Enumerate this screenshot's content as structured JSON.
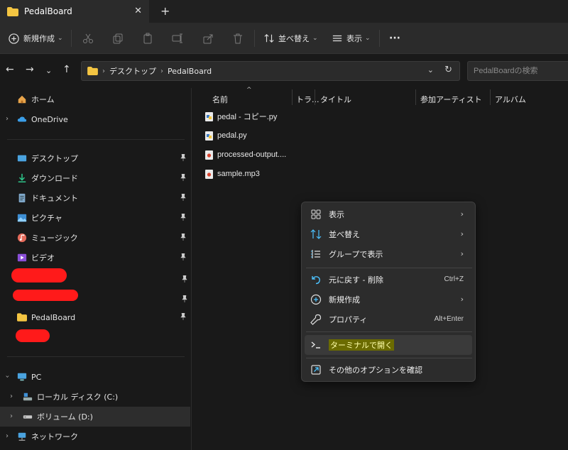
{
  "window": {
    "tab_title": "PedalBoard",
    "tab_close": "✕",
    "tab_add": "+"
  },
  "toolbar": {
    "new_label": "新規作成",
    "sort_label": "並べ替え",
    "view_label": "表示",
    "more": "···"
  },
  "address": {
    "crumbs": [
      "デスクトップ",
      "PedalBoard"
    ],
    "search_placeholder": "PedalBoardの検索"
  },
  "sidebar": {
    "items": [
      {
        "label": "ホーム"
      },
      {
        "label": "OneDrive"
      },
      {
        "label": "デスクトップ"
      },
      {
        "label": "ダウンロード"
      },
      {
        "label": "ドキュメント"
      },
      {
        "label": "ピクチャ"
      },
      {
        "label": "ミュージック"
      },
      {
        "label": "ビデオ"
      },
      {
        "label": "PedalBoard"
      },
      {
        "label": "PC"
      },
      {
        "label": "ローカル ディスク (C:)"
      },
      {
        "label": "ボリューム (D:)"
      },
      {
        "label": "ネットワーク"
      }
    ]
  },
  "columns": [
    "名前",
    "トラ...",
    "タイトル",
    "参加アーティスト",
    "アルバム"
  ],
  "files": [
    {
      "name": "pedal - コピー.py"
    },
    {
      "name": "pedal.py"
    },
    {
      "name": "processed-output...."
    },
    {
      "name": "sample.mp3"
    }
  ],
  "context_menu": {
    "items": [
      {
        "label": "表示",
        "arrow": "›"
      },
      {
        "label": "並べ替え",
        "arrow": "›"
      },
      {
        "label": "グループで表示",
        "arrow": "›"
      },
      {
        "label": "元に戻す - 削除",
        "shortcut": "Ctrl+Z"
      },
      {
        "label": "新規作成",
        "arrow": "›"
      },
      {
        "label": "プロパティ",
        "shortcut": "Alt+Enter"
      },
      {
        "label": "ターミナルで開く"
      },
      {
        "label": "その他のオプションを確認"
      }
    ]
  },
  "colors": {
    "accent": "#4cc2ff",
    "folder": "#f4c542",
    "redaction": "#ff1a1a",
    "highlight": "#6b6b00"
  }
}
